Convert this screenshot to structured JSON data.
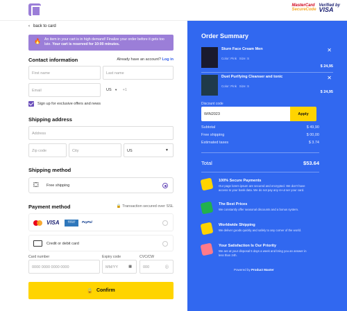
{
  "header": {
    "mastercard_line1": "MasterCard",
    "mastercard_line2": "SecureCode",
    "visa_line1": "Verified by",
    "visa_line2": "VISA"
  },
  "back": {
    "label": "back to card"
  },
  "alert": {
    "text": "An item in your cart is in high demand! Finalize your order before it gets too late.",
    "bold": "Your cart is reserved for 10:00 minutes."
  },
  "contact": {
    "title": "Contact information",
    "account_prompt": "Already have an account?",
    "login": "Log in",
    "first_name_placeholder": "First name",
    "last_name_placeholder": "Last name",
    "email_placeholder": "Email",
    "country_code": "US",
    "phone_prefix": "+1",
    "signup_label": "Sign up for exclusive offers and news"
  },
  "shipping_address": {
    "title": "Shipping address",
    "address_placeholder": "Address",
    "zip_placeholder": "Zip code",
    "city_placeholder": "City",
    "country": "US"
  },
  "shipping_method": {
    "title": "Shipping method",
    "option": "Free shipping"
  },
  "payment": {
    "title": "Payment method",
    "secure_note": "Transaction secured over SSL",
    "card_labels": [
      "MasterCard",
      "VISA",
      "AMERICAN EXPRESS",
      "PayPal"
    ],
    "card_option": "Credit or debit card",
    "card_number_label": "Card number",
    "card_number_placeholder": "0000 0000 0000 0000",
    "expiry_label": "Expiry code",
    "expiry_placeholder": "MM/YY",
    "cvc_label": "CVC/CW",
    "cvc_placeholder": "000"
  },
  "confirm": {
    "label": "Confirm"
  },
  "summary": {
    "title": "Order Summary",
    "items": [
      {
        "name": "Sturn Face Cream Men",
        "color": "Color: Pink",
        "size": "Size: S",
        "price": "$ 24,95"
      },
      {
        "name": "Duet Purifying Cleanser and tonic",
        "color": "Color: Pink",
        "size": "Size: S",
        "price": "$ 24,95"
      }
    ],
    "discount_label": "Discount code",
    "discount_value": "WIN2023",
    "apply": "Apply",
    "subtotal_label": "Subtotal",
    "subtotal": "$ 49,90",
    "shipping_label": "Free shipping",
    "shipping": "$ 00,00",
    "taxes_label": "Estimated taxes",
    "taxes": "$ 3.74",
    "total_label": "Total",
    "total": "$53.64",
    "features": [
      {
        "title": "100% Secure Payments",
        "desc": "Our page lorem ipsum are secured and encrypted. We don't have access to your bank data. We do not pay any re-ut ser your card."
      },
      {
        "title": "The Best Prices",
        "desc": "We constantly offer seasonal discounts and a bonus system."
      },
      {
        "title": "Worldwide Shipping",
        "desc": "We deliver goods quickly and safely to any corner of the world."
      },
      {
        "title": "Your Satisfaction Is Our Priority",
        "desc": "We are at your disposal 5 days a week and bring you an answer in less than 24h."
      }
    ],
    "powered_prefix": "Powered by",
    "powered_brand": "Product Master"
  },
  "colors": {
    "accent": "#3168f0",
    "brand": "#9b7ed8",
    "button": "#ffd400"
  }
}
